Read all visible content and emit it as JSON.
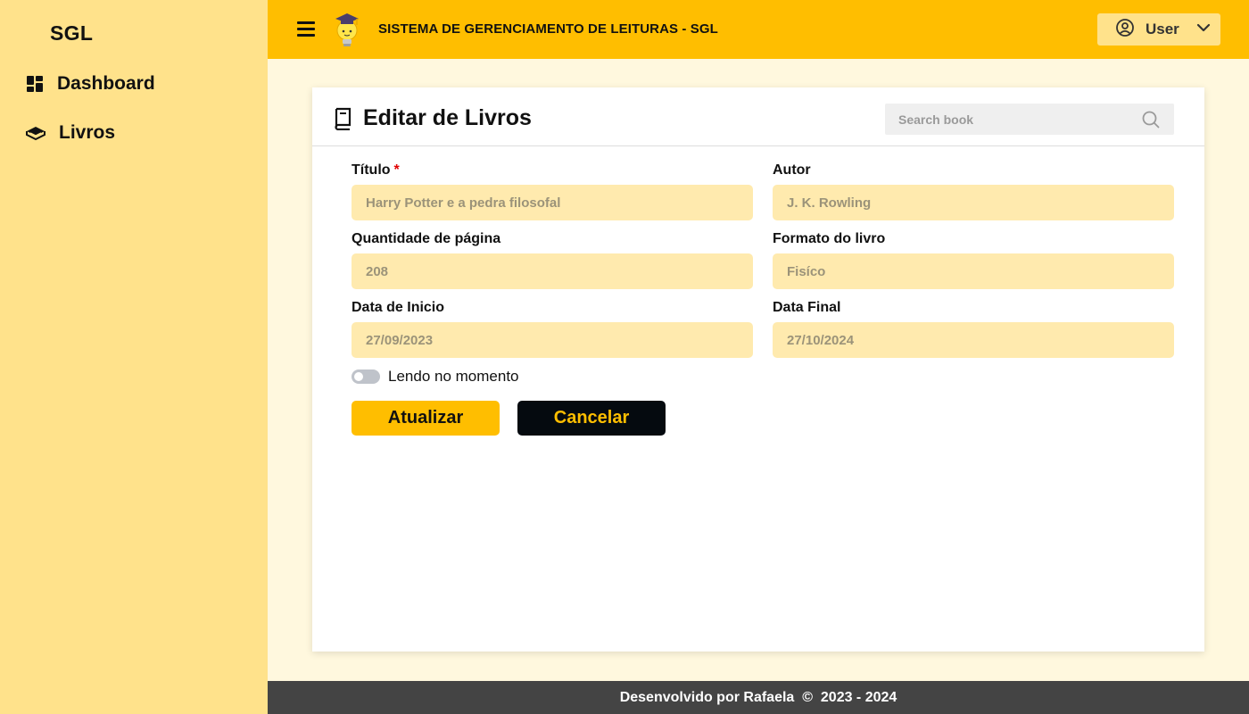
{
  "sidebar": {
    "brand": "SGL",
    "items": [
      {
        "label": "Dashboard",
        "icon": "dashboard-icon"
      },
      {
        "label": "Livros",
        "icon": "book-icon"
      }
    ]
  },
  "header": {
    "title": "SISTEMA DE GERENCIAMENTO DE LEITURAS - SGL",
    "user_label": "User",
    "colors": {
      "accent": "#FFBE00",
      "sidebar": "#FFE28B"
    }
  },
  "card": {
    "title": "Editar de Livros",
    "search_placeholder": "Search book"
  },
  "form": {
    "titulo": {
      "label": "Título",
      "required_mark": "*",
      "value": "Harry Potter e a pedra filosofal"
    },
    "autor": {
      "label": "Autor",
      "value": "J. K. Rowling"
    },
    "paginas": {
      "label": "Quantidade de página",
      "value": "208"
    },
    "formato": {
      "label": "Formato do livro",
      "value": "Fisíco"
    },
    "inicio": {
      "label": "Data de Inicio",
      "value": "27/09/2023"
    },
    "final": {
      "label": "Data Final",
      "value": "27/10/2024"
    },
    "toggle_label": "Lendo no momento",
    "toggle_on": false,
    "update_label": "Atualizar",
    "cancel_label": "Cancelar"
  },
  "footer": {
    "text": "Desenvolvido por Rafaela  ©  2023 - 2024"
  }
}
